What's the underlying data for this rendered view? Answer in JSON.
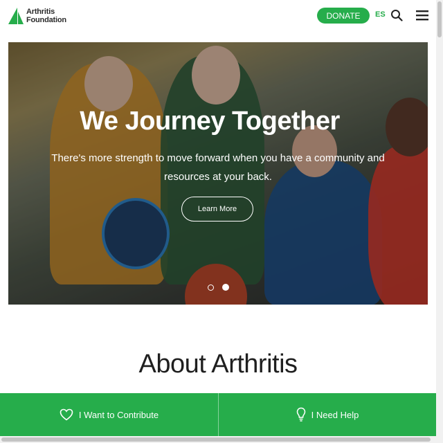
{
  "header": {
    "logo_line1": "Arthritis",
    "logo_line2": "Foundation",
    "donate_label": "DONATE",
    "language_label": "ES",
    "brand_color": "#26ad4b"
  },
  "hero": {
    "title": "We Journey Together",
    "subtitle": "There's more strength to move forward when you have a community and resources at your back.",
    "button_label": "Learn More",
    "carousel_slides": 2,
    "active_slide": 2
  },
  "about": {
    "title": "About Arthritis"
  },
  "bottom_bar": {
    "contribute_label": "I Want to Contribute",
    "help_label": "I Need Help"
  },
  "icons": [
    "logo-mark-icon",
    "search-icon",
    "menu-icon",
    "heart-icon",
    "lightbulb-icon"
  ]
}
